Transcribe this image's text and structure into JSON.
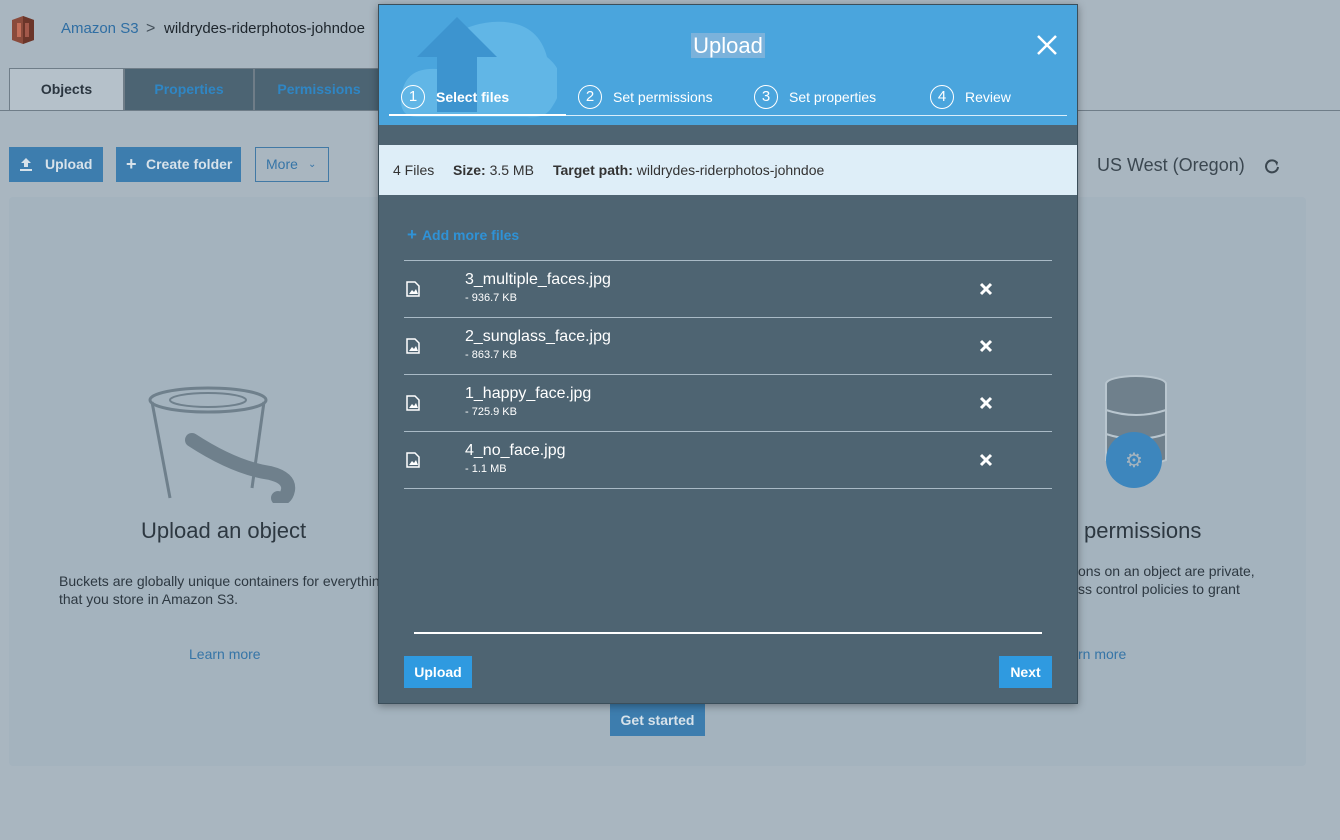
{
  "breadcrumb": {
    "root": "Amazon S3",
    "separator": ">",
    "current": "wildrydes-riderphotos-johndoe"
  },
  "tabs": [
    {
      "label": "Objects"
    },
    {
      "label": "Properties"
    },
    {
      "label": "Permissions"
    }
  ],
  "toolbar": {
    "upload_label": "Upload",
    "create_folder_label": "Create folder",
    "more_label": "More"
  },
  "region": {
    "label": "US West (Oregon)"
  },
  "background": {
    "upload_card": {
      "title": "Upload an object",
      "text_line1": "Buckets are globally unique containers for everythin",
      "text_line2": "that you store in Amazon S3.",
      "learn_more": "Learn more"
    },
    "permissions_card": {
      "title": "permissions",
      "text_line1": "ons on an object are private,",
      "text_line2": "ss control policies to grant",
      "learn_more": "rn more"
    },
    "get_started": "Get started"
  },
  "modal": {
    "title": "Upload",
    "steps": [
      {
        "num": "1",
        "label": "Select files",
        "active": true
      },
      {
        "num": "2",
        "label": "Set permissions",
        "active": false
      },
      {
        "num": "3",
        "label": "Set properties",
        "active": false
      },
      {
        "num": "4",
        "label": "Review",
        "active": false
      }
    ],
    "info": {
      "file_count": "4 Files",
      "size_label": "Size:",
      "size_value": "3.5 MB",
      "target_label": "Target path:",
      "target_value": "wildrydes-riderphotos-johndoe"
    },
    "add_more_label": "Add more files",
    "files": [
      {
        "name": "3_multiple_faces.jpg",
        "size": "- 936.7 KB"
      },
      {
        "name": "2_sunglass_face.jpg",
        "size": "- 863.7 KB"
      },
      {
        "name": "1_happy_face.jpg",
        "size": "- 725.9 KB"
      },
      {
        "name": "4_no_face.jpg",
        "size": "- 1.1 MB"
      }
    ],
    "upload_button": "Upload",
    "next_button": "Next"
  },
  "colors": {
    "modal_header": "#4aa5dd",
    "modal_body": "#4e6472",
    "primary_button": "#2f9ae0",
    "page_background": "#a9b6c0"
  },
  "icons": {
    "logo": "s3-bucket-logo-icon",
    "refresh": "refresh-icon",
    "close": "close-icon",
    "file": "image-file-icon",
    "remove": "remove-x-icon",
    "plus": "plus-icon"
  }
}
